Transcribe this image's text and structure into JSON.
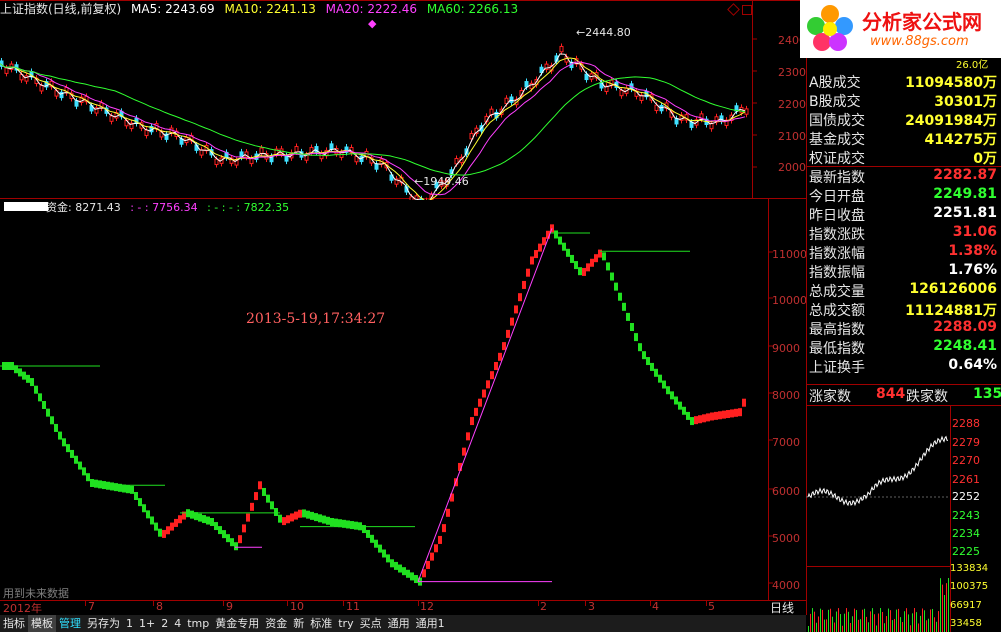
{
  "header": {
    "title": "上证指数(日线,前复权)",
    "ma": [
      {
        "label": "MA5: 2243.69",
        "color": "#ffffff"
      },
      {
        "label": "MA10: 2241.13",
        "color": "#ffff30"
      },
      {
        "label": "MA20: 2222.46",
        "color": "#ff40ff"
      },
      {
        "label": "MA60: 2266.13",
        "color": "#30ff30"
      }
    ]
  },
  "main_chart": {
    "high_label": "2444.80",
    "low_label": "1949.46",
    "y_ticks": [
      "2400",
      "2300",
      "2200",
      "2100",
      "2000"
    ]
  },
  "sub_header": {
    "label": "资金: 8271.43",
    "v2": ": - : 7756.34",
    "v3": ": - : - : 7822.35"
  },
  "sub_chart": {
    "timestamp": "2013-5-19,17:34:27",
    "y_ticks": [
      "11000",
      "10000",
      "9000",
      "8000",
      "7000",
      "6000",
      "5000",
      "4000"
    ],
    "footnote": "用到未来数据"
  },
  "x_axis": {
    "labels": [
      "2012年",
      "7",
      "8",
      "9",
      "10",
      "11",
      "12",
      "2",
      "3",
      "4",
      "5"
    ],
    "period": "日线"
  },
  "tabs": [
    {
      "label": "指标",
      "active": false
    },
    {
      "label": "模板",
      "active": true
    },
    {
      "label": "管理",
      "active": false,
      "hot": true
    },
    {
      "label": "另存为",
      "active": false
    },
    {
      "label": "1",
      "active": false
    },
    {
      "label": "1+",
      "active": false
    },
    {
      "label": "2",
      "active": false
    },
    {
      "label": "4",
      "active": false
    },
    {
      "label": "tmp",
      "active": false
    },
    {
      "label": "黄金专用",
      "active": false
    },
    {
      "label": "资金",
      "active": false
    },
    {
      "label": "新",
      "active": false
    },
    {
      "label": "标准",
      "active": false
    },
    {
      "label": "try",
      "active": false
    },
    {
      "label": "买点",
      "active": false
    },
    {
      "label": "通用",
      "active": false
    },
    {
      "label": "通用1",
      "active": false
    }
  ],
  "logo": {
    "name": "分析家公式网",
    "url_text": "www.88gs.com"
  },
  "panel": {
    "top_partial": "26.0亿",
    "rows": [
      {
        "k": "A股成交",
        "v": "11094580万",
        "c": "yellow"
      },
      {
        "k": "B股成交",
        "v": "30301万",
        "c": "yellow"
      },
      {
        "k": "国债成交",
        "v": "24091984万",
        "c": "yellow"
      },
      {
        "k": "基金成交",
        "v": "414275万",
        "c": "yellow"
      },
      {
        "k": "权证成交",
        "v": "0万",
        "c": "yellow"
      },
      {
        "k": "最新指数",
        "v": "2282.87",
        "c": "red"
      },
      {
        "k": "今日开盘",
        "v": "2249.81",
        "c": "green"
      },
      {
        "k": "昨日收盘",
        "v": "2251.81",
        "c": "white"
      },
      {
        "k": "指数涨跌",
        "v": "31.06",
        "c": "red"
      },
      {
        "k": "指数涨幅",
        "v": "1.38%",
        "c": "red"
      },
      {
        "k": "指数振幅",
        "v": "1.76%",
        "c": "white"
      },
      {
        "k": "总成交量",
        "v": "126126006",
        "c": "yellow"
      },
      {
        "k": "总成交额",
        "v": "11124881万",
        "c": "yellow"
      },
      {
        "k": "最高指数",
        "v": "2288.09",
        "c": "red"
      },
      {
        "k": "最低指数",
        "v": "2248.41",
        "c": "green"
      },
      {
        "k": "上证换手",
        "v": "0.64%",
        "c": "white"
      }
    ],
    "adv_label": "涨家数",
    "adv_value": "844",
    "dec_label": "跌家数",
    "dec_value": "135"
  },
  "mini_chart": {
    "price_ticks": [
      "2288",
      "2279",
      "2270",
      "2261",
      "2252",
      "2243",
      "2234",
      "2225"
    ],
    "vol_ticks": [
      "133834",
      "100375",
      "66917",
      "33458"
    ]
  },
  "colors": {
    "grid": "#a00000",
    "up": "#ff2020",
    "down": "#20e020",
    "ma5": "#ffffff",
    "ma10": "#ffff30",
    "ma20": "#ff40ff",
    "ma60": "#30ff30",
    "accent": "#ff4040"
  }
}
